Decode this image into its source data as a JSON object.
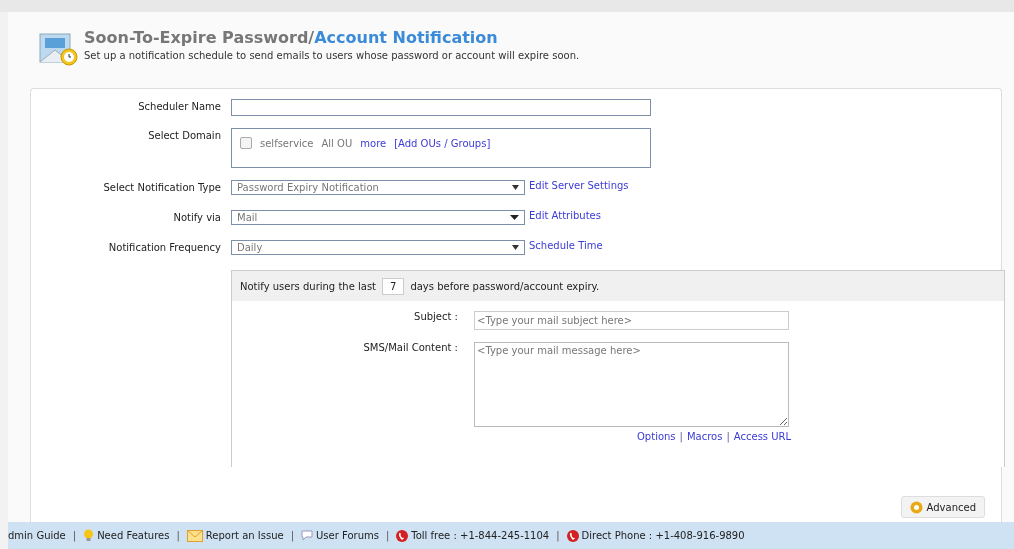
{
  "header": {
    "title_part1": "Soon-To-Expire Password/",
    "title_part2": "Account Notification",
    "subtitle": "Set up a notification schedule to send emails to users whose password or account will expire soon."
  },
  "form": {
    "scheduler_name": {
      "label": "Scheduler Name"
    },
    "domain": {
      "label": "Select Domain",
      "checked": false,
      "name": "selfservice",
      "ou": "All OU",
      "more": "more",
      "add": "[Add OUs / Groups]"
    },
    "selects": [
      {
        "label": "Select Notification Type",
        "value": "Password Expiry Notification",
        "link": "Edit Server Settings"
      },
      {
        "label": "Notify via",
        "value": "Mail",
        "link": "Edit Attributes"
      },
      {
        "label": "Notification Frequency",
        "value": "Daily",
        "link": "Schedule Time"
      }
    ],
    "notify": {
      "before": "Notify users during the last",
      "days": "7",
      "after": "days before password/account expiry."
    },
    "subject": {
      "label": "Subject :",
      "placeholder": "<Type your mail subject here>"
    },
    "content": {
      "label": "SMS/Mail Content :",
      "placeholder": "<Type your mail message here>"
    },
    "content_links": [
      {
        "kind": "link",
        "label": "Options"
      },
      {
        "kind": "separator",
        "label": "|"
      },
      {
        "kind": "link",
        "label": "Macros"
      },
      {
        "kind": "separator",
        "label": "|"
      },
      {
        "kind": "link",
        "label": "Access URL"
      }
    ],
    "advanced_button": "Advanced"
  },
  "footer": [
    {
      "kind": "link",
      "label": "dmin Guide"
    },
    {
      "kind": "separator",
      "label": "|"
    },
    {
      "kind": "link",
      "label": "Need Features"
    },
    {
      "kind": "separator",
      "label": "|"
    },
    {
      "kind": "link",
      "label": "Report an Issue"
    },
    {
      "kind": "separator",
      "label": "|"
    },
    {
      "kind": "link",
      "label": "User Forums"
    },
    {
      "kind": "separator",
      "label": "|"
    },
    {
      "kind": "link",
      "label": "Toll free : +1-844-245-1104"
    },
    {
      "kind": "separator",
      "label": "|"
    },
    {
      "kind": "link",
      "label": "Direct Phone : +1-408-916-9890"
    }
  ]
}
